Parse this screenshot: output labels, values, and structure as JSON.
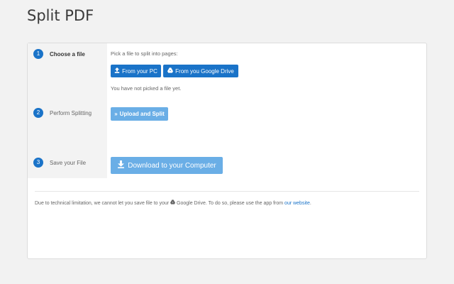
{
  "page": {
    "title": "Split PDF"
  },
  "steps": [
    {
      "num": "1",
      "label": "Choose a file"
    },
    {
      "num": "2",
      "label": "Perform Splitting"
    },
    {
      "num": "3",
      "label": "Save your File"
    }
  ],
  "choose": {
    "pick_label": "Pick a file to split into pages:",
    "from_pc_label": "From your PC",
    "from_drive_label": "From you Google Drive",
    "status": "You have not picked a file yet."
  },
  "split": {
    "button_label": "Upload and Split"
  },
  "save": {
    "button_label": "Download to your Computer"
  },
  "footer": {
    "text_before": "Due to technical limitation, we cannot let you save file to your",
    "text_middle": "Google Drive. To do so, please use the app from",
    "link_label": "our website",
    "text_after": "."
  },
  "colors": {
    "primary": "#1a73c8",
    "disabled": "#6aaee6",
    "background": "#f2f2f2"
  },
  "icons": {
    "upload": "upload-icon",
    "drive": "google-drive-icon",
    "forward": "double-chevron-right-icon",
    "download": "download-icon"
  }
}
